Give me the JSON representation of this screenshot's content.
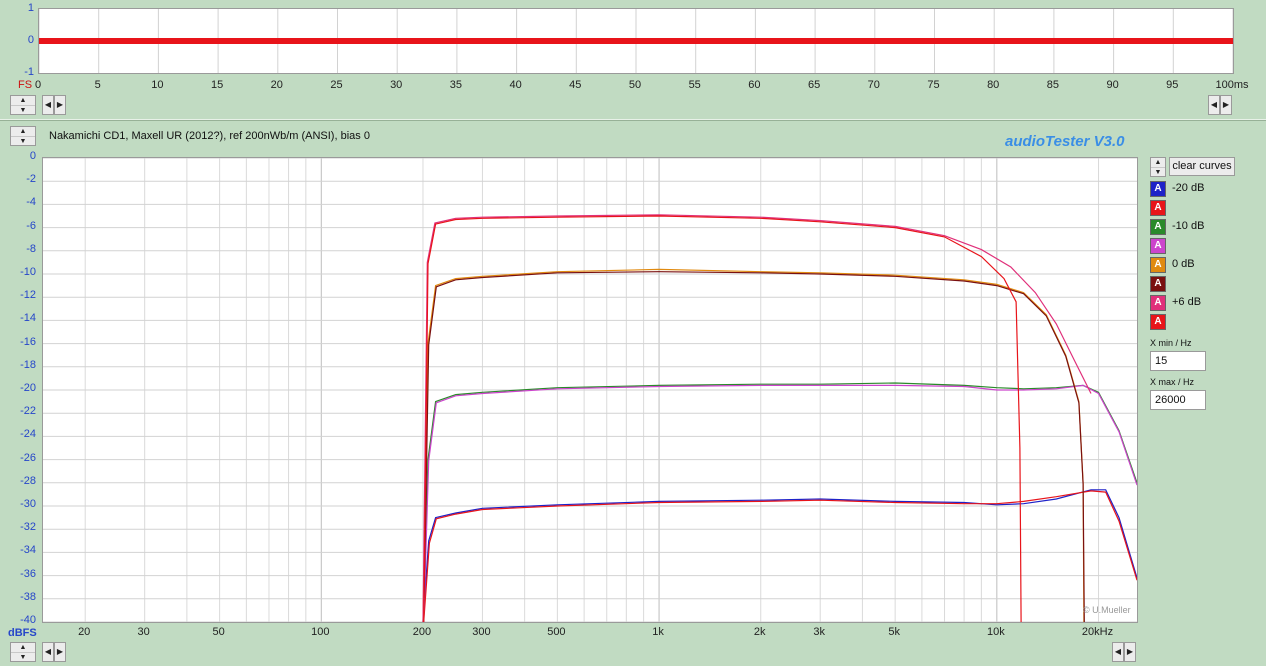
{
  "top_chart": {
    "y_ticks": [
      "1",
      "0",
      "-1"
    ],
    "y_unit": "FS",
    "x_ticks": [
      "0",
      "5",
      "10",
      "15",
      "20",
      "25",
      "30",
      "35",
      "40",
      "45",
      "50",
      "55",
      "60",
      "65",
      "70",
      "75",
      "80",
      "85",
      "90",
      "95",
      "100ms"
    ],
    "signal_value": 0,
    "signal_color": "#e8141a"
  },
  "header": {
    "title": "Nakamichi CD1, Maxell UR (2012?), ref 200nWb/m (ANSI), bias 0",
    "brand": "audioTester  V3.0"
  },
  "legend": {
    "clear_label": "clear curves",
    "items": [
      {
        "icon": "A",
        "label": "-20 dB",
        "color": "#1e22c8"
      },
      {
        "icon": "A",
        "label": "",
        "color": "#e8141a"
      },
      {
        "icon": "A",
        "label": "-10 dB",
        "color": "#2a8a2a"
      },
      {
        "icon": "A",
        "label": "",
        "color": "#cc44cc"
      },
      {
        "icon": "A",
        "label": "0 dB",
        "color": "#e08a10"
      },
      {
        "icon": "A",
        "label": "",
        "color": "#7a1010"
      },
      {
        "icon": "A",
        "label": "+6 dB",
        "color": "#e0307a"
      },
      {
        "icon": "A",
        "label": "",
        "color": "#e8141a"
      }
    ]
  },
  "controls": {
    "xmin_label": "X min / Hz",
    "xmin_value": "15",
    "xmax_label": "X max / Hz",
    "xmax_value": "26000"
  },
  "watermark": "© U.Mueller",
  "chart_data": {
    "type": "line",
    "ylabel": "dBFS",
    "ylim": [
      -40,
      0
    ],
    "y_ticks": [
      0,
      -2,
      -4,
      -6,
      -8,
      -10,
      -12,
      -14,
      -16,
      -18,
      -20,
      -22,
      -24,
      -26,
      -28,
      -30,
      -32,
      -34,
      -36,
      -38,
      -40
    ],
    "x_scale": "log",
    "xlim": [
      15,
      26000
    ],
    "x_ticks": [
      {
        "v": 20,
        "t": "20"
      },
      {
        "v": 30,
        "t": "30"
      },
      {
        "v": 50,
        "t": "50"
      },
      {
        "v": 100,
        "t": "100"
      },
      {
        "v": 200,
        "t": "200"
      },
      {
        "v": 300,
        "t": "300"
      },
      {
        "v": 500,
        "t": "500"
      },
      {
        "v": 1000,
        "t": "1k"
      },
      {
        "v": 2000,
        "t": "2k"
      },
      {
        "v": 3000,
        "t": "3k"
      },
      {
        "v": 5000,
        "t": "5k"
      },
      {
        "v": 10000,
        "t": "10k"
      },
      {
        "v": 20000,
        "t": "20kHz"
      }
    ],
    "grid": true,
    "series": [
      {
        "name": "-20 dB",
        "color": "#1e22c8",
        "points": [
          [
            200,
            -40
          ],
          [
            208,
            -33
          ],
          [
            218,
            -31
          ],
          [
            250,
            -30.6
          ],
          [
            300,
            -30.2
          ],
          [
            500,
            -29.9
          ],
          [
            1000,
            -29.6
          ],
          [
            2000,
            -29.5
          ],
          [
            3000,
            -29.4
          ],
          [
            5000,
            -29.6
          ],
          [
            8000,
            -29.7
          ],
          [
            10000,
            -29.9
          ],
          [
            12000,
            -29.8
          ],
          [
            15000,
            -29.4
          ],
          [
            19000,
            -28.6
          ],
          [
            21000,
            -28.6
          ],
          [
            23000,
            -31
          ],
          [
            26000,
            -36.2
          ]
        ]
      },
      {
        "name": "",
        "color": "#e8141a",
        "points": [
          [
            201,
            -40
          ],
          [
            209,
            -33.2
          ],
          [
            219,
            -31.1
          ],
          [
            250,
            -30.7
          ],
          [
            300,
            -30.3
          ],
          [
            500,
            -30
          ],
          [
            1000,
            -29.7
          ],
          [
            2000,
            -29.6
          ],
          [
            3000,
            -29.5
          ],
          [
            5000,
            -29.7
          ],
          [
            8000,
            -29.8
          ],
          [
            10000,
            -29.8
          ],
          [
            12000,
            -29.6
          ],
          [
            15000,
            -29.2
          ],
          [
            19000,
            -28.7
          ],
          [
            21000,
            -28.8
          ],
          [
            23000,
            -31.3
          ],
          [
            26000,
            -36.4
          ]
        ]
      },
      {
        "name": "-10 dB",
        "color": "#2a8a2a",
        "points": [
          [
            200,
            -40
          ],
          [
            207,
            -26
          ],
          [
            218,
            -21
          ],
          [
            250,
            -20.4
          ],
          [
            300,
            -20.2
          ],
          [
            500,
            -19.8
          ],
          [
            1000,
            -19.6
          ],
          [
            2000,
            -19.5
          ],
          [
            3000,
            -19.5
          ],
          [
            5000,
            -19.4
          ],
          [
            8000,
            -19.6
          ],
          [
            10000,
            -19.8
          ],
          [
            12000,
            -19.9
          ],
          [
            15000,
            -19.8
          ],
          [
            18000,
            -19.6
          ],
          [
            20000,
            -20.2
          ],
          [
            23000,
            -23.5
          ],
          [
            26000,
            -28
          ]
        ]
      },
      {
        "name": "",
        "color": "#cc44cc",
        "points": [
          [
            201,
            -40
          ],
          [
            208,
            -26.1
          ],
          [
            219,
            -21.1
          ],
          [
            250,
            -20.5
          ],
          [
            300,
            -20.3
          ],
          [
            500,
            -19.9
          ],
          [
            1000,
            -19.7
          ],
          [
            2000,
            -19.6
          ],
          [
            3000,
            -19.6
          ],
          [
            5000,
            -19.6
          ],
          [
            8000,
            -19.7
          ],
          [
            10000,
            -20
          ],
          [
            12000,
            -20
          ],
          [
            15000,
            -19.9
          ],
          [
            18000,
            -19.6
          ],
          [
            20000,
            -20.3
          ],
          [
            23000,
            -23.6
          ],
          [
            26000,
            -28.2
          ]
        ]
      },
      {
        "name": "0 dB",
        "color": "#e08a10",
        "points": [
          [
            200,
            -40
          ],
          [
            207,
            -16
          ],
          [
            218,
            -11
          ],
          [
            250,
            -10.4
          ],
          [
            300,
            -10.2
          ],
          [
            500,
            -9.8
          ],
          [
            1000,
            -9.6
          ],
          [
            2000,
            -9.8
          ],
          [
            3000,
            -9.9
          ],
          [
            5000,
            -10.1
          ],
          [
            8000,
            -10.5
          ],
          [
            10000,
            -10.9
          ],
          [
            12000,
            -11.6
          ],
          [
            14000,
            -13.5
          ],
          [
            16000,
            -17
          ],
          [
            17500,
            -21
          ],
          [
            18000,
            -28
          ],
          [
            18100,
            -40
          ]
        ]
      },
      {
        "name": "",
        "color": "#7a1010",
        "points": [
          [
            201,
            -40
          ],
          [
            208,
            -16.1
          ],
          [
            219,
            -11.1
          ],
          [
            250,
            -10.5
          ],
          [
            300,
            -10.3
          ],
          [
            500,
            -9.9
          ],
          [
            1000,
            -9.8
          ],
          [
            2000,
            -9.9
          ],
          [
            3000,
            -10
          ],
          [
            5000,
            -10.2
          ],
          [
            8000,
            -10.6
          ],
          [
            10000,
            -11
          ],
          [
            12000,
            -11.7
          ],
          [
            14000,
            -13.6
          ],
          [
            16000,
            -17.1
          ],
          [
            17500,
            -21.1
          ],
          [
            18000,
            -28.1
          ],
          [
            18150,
            -40
          ]
        ]
      },
      {
        "name": "+6 dB",
        "color": "#e0307a",
        "points": [
          [
            200,
            -40
          ],
          [
            206,
            -9
          ],
          [
            217,
            -5.6
          ],
          [
            250,
            -5.2
          ],
          [
            300,
            -5.1
          ],
          [
            500,
            -5
          ],
          [
            1000,
            -4.9
          ],
          [
            2000,
            -5.1
          ],
          [
            3000,
            -5.4
          ],
          [
            5000,
            -5.9
          ],
          [
            7000,
            -6.7
          ],
          [
            9000,
            -7.9
          ],
          [
            11000,
            -9.4
          ],
          [
            13000,
            -11.6
          ],
          [
            15000,
            -14.3
          ],
          [
            17000,
            -17.5
          ],
          [
            19000,
            -20.3
          ]
        ]
      },
      {
        "name": "",
        "color": "#e8141a",
        "points": [
          [
            201,
            -40
          ],
          [
            207,
            -9.1
          ],
          [
            218,
            -5.7
          ],
          [
            250,
            -5.3
          ],
          [
            300,
            -5.2
          ],
          [
            500,
            -5.1
          ],
          [
            1000,
            -5
          ],
          [
            2000,
            -5.2
          ],
          [
            3000,
            -5.5
          ],
          [
            5000,
            -6
          ],
          [
            7000,
            -6.8
          ],
          [
            9000,
            -8.5
          ],
          [
            10500,
            -10.4
          ],
          [
            11400,
            -12.4
          ],
          [
            11700,
            -25
          ],
          [
            11800,
            -40
          ]
        ]
      }
    ]
  }
}
